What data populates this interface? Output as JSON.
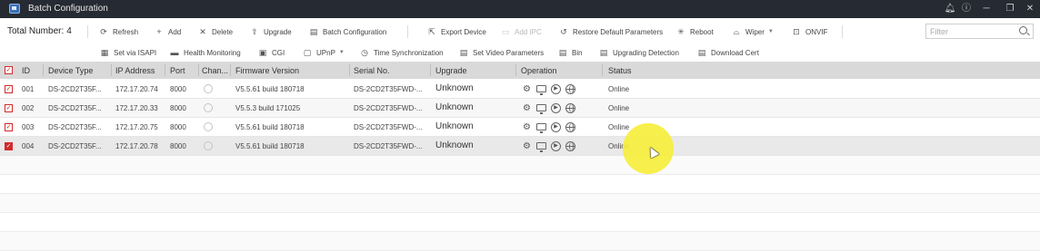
{
  "window": {
    "title": "Batch Configuration"
  },
  "toolbar": {
    "total_label": "Total Number:",
    "total_count": "4",
    "row1": [
      {
        "label": "Refresh",
        "icon": "refresh-icon",
        "glyph": "⟳",
        "disabled": false
      },
      {
        "label": "Add",
        "icon": "plus-icon",
        "glyph": "+",
        "disabled": false
      },
      {
        "label": "Delete",
        "icon": "close-icon",
        "glyph": "✕",
        "disabled": false
      },
      {
        "label": "Upgrade",
        "icon": "upgrade-icon",
        "glyph": "⇪",
        "disabled": false
      },
      {
        "label": "Batch Configuration",
        "icon": "batch-config-icon",
        "glyph": "▤",
        "disabled": false
      },
      {
        "label": "Export Device",
        "icon": "export-icon",
        "glyph": "⇱",
        "disabled": false
      },
      {
        "label": "Add IPC",
        "icon": "add-ipc-icon",
        "glyph": "▭",
        "disabled": true
      },
      {
        "label": "Restore Default Parameters",
        "icon": "restore-icon",
        "glyph": "↺",
        "disabled": false
      },
      {
        "label": "Reboot",
        "icon": "reboot-icon",
        "glyph": "✳",
        "disabled": false
      },
      {
        "label": "Wiper",
        "icon": "wiper-icon",
        "glyph": "⌓",
        "disabled": false,
        "dropdown": true
      },
      {
        "label": "ONVIF",
        "icon": "onvif-icon",
        "glyph": "⊡",
        "disabled": false
      }
    ],
    "row2": [
      {
        "label": "Set via ISAPI",
        "icon": "isapi-icon",
        "glyph": "▦"
      },
      {
        "label": "Health Monitoring",
        "icon": "health-icon",
        "glyph": "▬"
      },
      {
        "label": "CGI",
        "icon": "cgi-icon",
        "glyph": "▣"
      },
      {
        "label": "UPnP",
        "icon": "upnp-icon",
        "glyph": "▢",
        "dropdown": true
      },
      {
        "label": "Time Synchronization",
        "icon": "clock-icon",
        "glyph": "◷"
      },
      {
        "label": "Set Video Parameters",
        "icon": "video-params-icon",
        "glyph": "▤"
      },
      {
        "label": "Bin",
        "icon": "bin-icon",
        "glyph": "▤"
      },
      {
        "label": "Upgrading Detection",
        "icon": "detection-icon",
        "glyph": "▤"
      },
      {
        "label": "Download Cert",
        "icon": "cert-icon",
        "glyph": "▤"
      }
    ],
    "filter_placeholder": "Filter"
  },
  "table": {
    "columns": [
      "ID",
      "Device Type",
      "IP Address",
      "Port",
      "Chan...",
      "Firmware Version",
      "Serial No.",
      "Upgrade",
      "Operation",
      "Status"
    ],
    "rows": [
      {
        "id": "001",
        "device_type": "DS-2CD2T35F...",
        "ip": "172.17.20.74",
        "port": "8000",
        "firmware": "V5.5.61 build 180718",
        "serial": "DS-2CD2T35FWD-...",
        "upgrade": "Unknown",
        "status": "Online",
        "checked": true,
        "selected": false
      },
      {
        "id": "002",
        "device_type": "DS-2CD2T35F...",
        "ip": "172.17.20.33",
        "port": "8000",
        "firmware": "V5.5.3 build 171025",
        "serial": "DS-2CD2T35FWD-...",
        "upgrade": "Unknown",
        "status": "Online",
        "checked": true,
        "selected": false
      },
      {
        "id": "003",
        "device_type": "DS-2CD2T35F...",
        "ip": "172.17.20.75",
        "port": "8000",
        "firmware": "V5.5.61 build 180718",
        "serial": "DS-2CD2T35FWD-...",
        "upgrade": "Unknown",
        "status": "Online",
        "checked": true,
        "selected": false
      },
      {
        "id": "004",
        "device_type": "DS-2CD2T35F...",
        "ip": "172.17.20.78",
        "port": "8000",
        "firmware": "V5.5.61 build 180718",
        "serial": "DS-2CD2T35FWD-...",
        "upgrade": "Unknown",
        "status": "Online",
        "checked": true,
        "selected": true
      }
    ]
  },
  "colors": {
    "titlebar": "#262a32",
    "accent_red": "#d32a2a",
    "header_bg": "#d9d9d9",
    "cursor_highlight": "#f6ee3c"
  }
}
